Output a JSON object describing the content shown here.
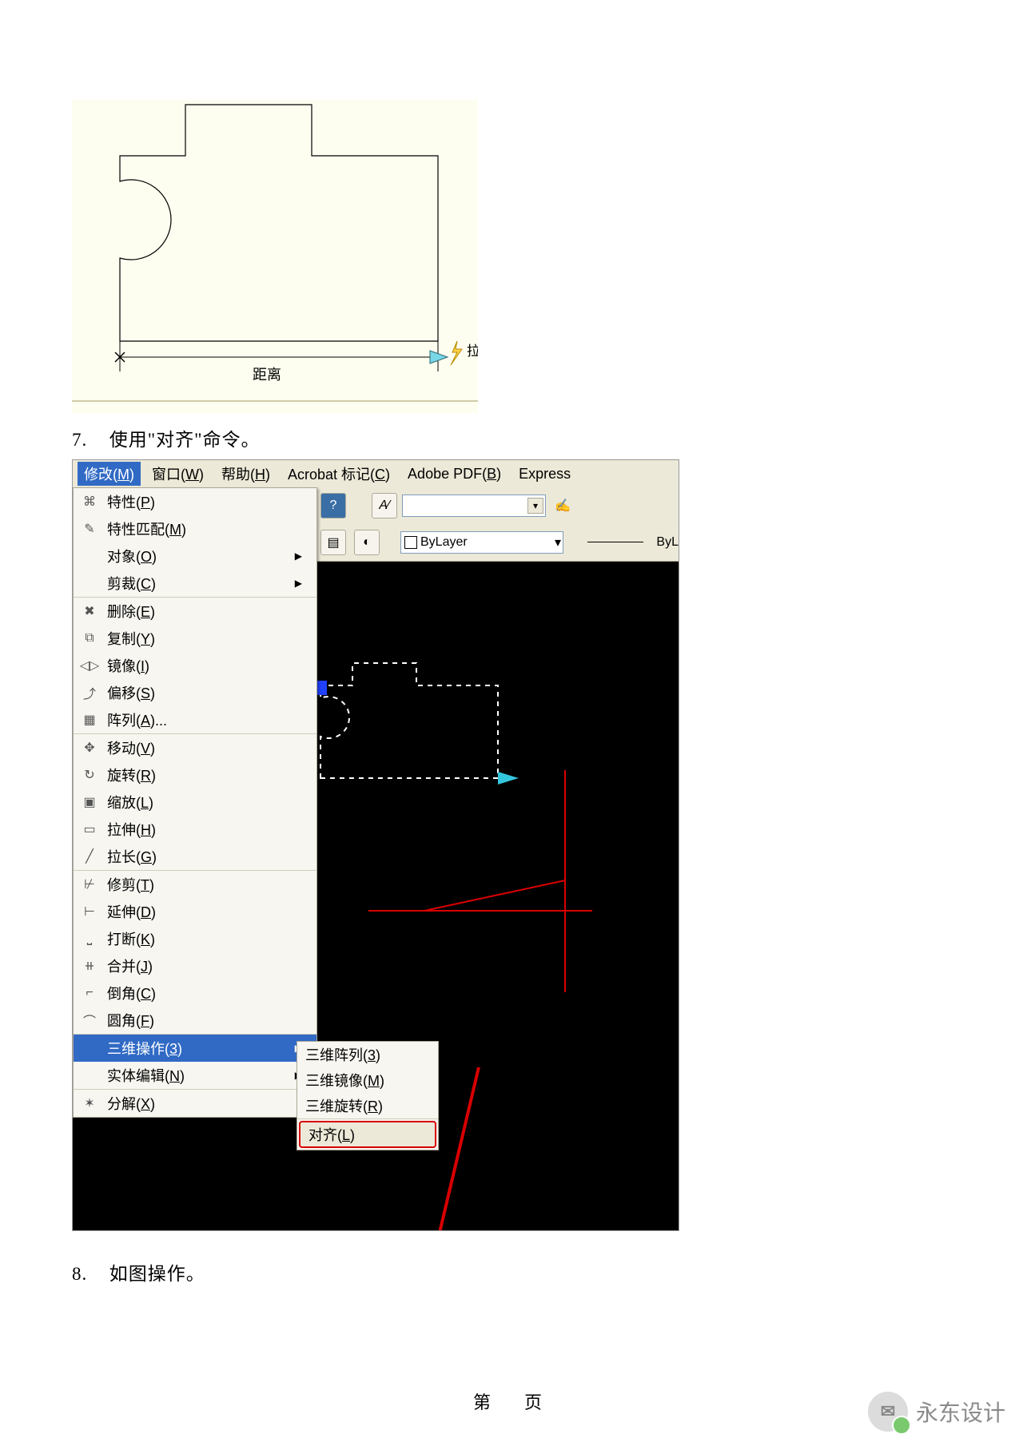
{
  "doc": {
    "step7_num": "7.",
    "step7_text": "使用\"对齐\"命令。",
    "step8_num": "8.",
    "step8_text": "如图操作。",
    "footer": "第　页",
    "watermark": "永东设计"
  },
  "fig1": {
    "stretch_label": "拉伸",
    "distance_label": "距离"
  },
  "menubar": {
    "modify": "修改",
    "modify_m": "M",
    "window": "窗口",
    "window_m": "W",
    "help": "帮助",
    "help_m": "H",
    "acrobat": "Acrobat 标记",
    "acrobat_m": "C",
    "adobe": "Adobe PDF",
    "adobe_m": "B",
    "express": "Express"
  },
  "toolbar": {
    "bylayer": "ByLayer",
    "byl_tail": "ByL"
  },
  "menu": {
    "groups": [
      [
        {
          "icon": "⌘",
          "label": "特性",
          "m": "P"
        },
        {
          "icon": "✎",
          "label": "特性匹配",
          "m": "M"
        },
        {
          "icon": "",
          "label": "对象",
          "m": "O",
          "sub": true
        },
        {
          "icon": "",
          "label": "剪裁",
          "m": "C",
          "sub": true
        }
      ],
      [
        {
          "icon": "✖",
          "label": "删除",
          "m": "E"
        },
        {
          "icon": "⧉",
          "label": "复制",
          "m": "Y"
        },
        {
          "icon": "◁▷",
          "label": "镜像",
          "m": "I"
        },
        {
          "icon": "⤴",
          "label": "偏移",
          "m": "S"
        },
        {
          "icon": "▦",
          "label": "阵列",
          "m": "A",
          "ellipsis": true
        }
      ],
      [
        {
          "icon": "✥",
          "label": "移动",
          "m": "V"
        },
        {
          "icon": "↻",
          "label": "旋转",
          "m": "R"
        },
        {
          "icon": "▣",
          "label": "缩放",
          "m": "L"
        },
        {
          "icon": "▭",
          "label": "拉伸",
          "m": "H"
        },
        {
          "icon": "╱",
          "label": "拉长",
          "m": "G"
        }
      ],
      [
        {
          "icon": "⊬",
          "label": "修剪",
          "m": "T"
        },
        {
          "icon": "⊢",
          "label": "延伸",
          "m": "D"
        },
        {
          "icon": "⎵",
          "label": "打断",
          "m": "K"
        },
        {
          "icon": "⧺",
          "label": "合并",
          "m": "J"
        },
        {
          "icon": "⌐",
          "label": "倒角",
          "m": "C"
        },
        {
          "icon": "⌒",
          "label": "圆角",
          "m": "F"
        }
      ],
      [
        {
          "icon": "",
          "label": "三维操作",
          "m": "3",
          "sub": true,
          "hl": true
        },
        {
          "icon": "",
          "label": "实体编辑",
          "m": "N",
          "sub": true
        }
      ],
      [
        {
          "icon": "✶",
          "label": "分解",
          "m": "X"
        }
      ]
    ]
  },
  "submenu": {
    "items": [
      {
        "label": "三维阵列",
        "m": "3"
      },
      {
        "label": "三维镜像",
        "m": "M"
      },
      {
        "label": "三维旋转",
        "m": "R",
        "sep_after": true
      },
      {
        "label": "对齐",
        "m": "L",
        "selected": true
      }
    ]
  }
}
